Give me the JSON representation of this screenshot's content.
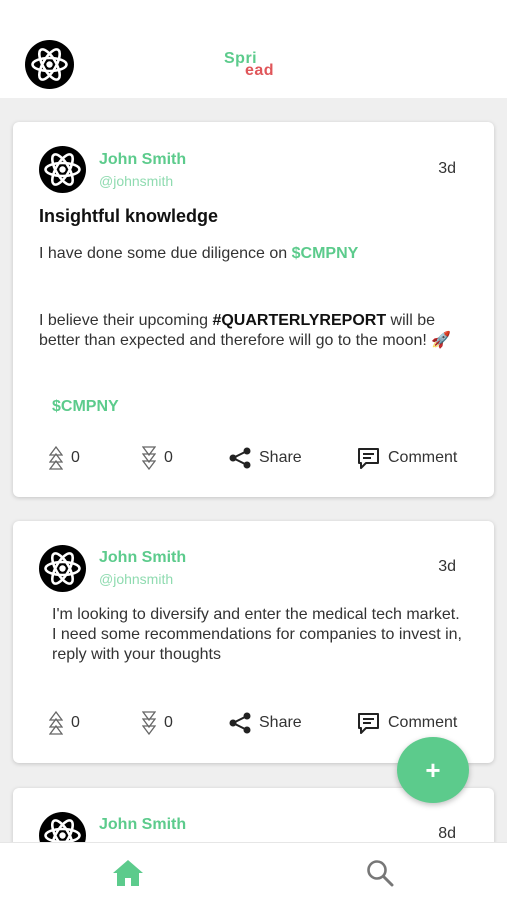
{
  "app": {
    "logo_top": "Spri",
    "logo_bottom": "ead",
    "accent_color": "#5ccb8c",
    "secondary_color": "#e0565a"
  },
  "posts": [
    {
      "author": "John Smith",
      "handle": "@johnsmith",
      "age": "3d",
      "title": "Insightful knowledge",
      "body_1_prefix": "I have done some due diligence on ",
      "body_1_ticker": "$CMPNY",
      "body_2_prefix": "I believe their upcoming ",
      "body_2_hashtag": "#QUARTERLYREPORT",
      "body_2_suffix": " will be better than expected and therefore will go to the moon! 🚀",
      "tag": "$CMPNY",
      "upvotes": "0",
      "downvotes": "0",
      "share_label": "Share",
      "comment_label": "Comment"
    },
    {
      "author": "John Smith",
      "handle": "@johnsmith",
      "age": "3d",
      "body_line_1": "I'm looking to diversify and enter the medical tech market.",
      "body_line_2": "I need some recommendations for companies to invest in, reply with your thoughts",
      "upvotes": "0",
      "downvotes": "0",
      "share_label": "Share",
      "comment_label": "Comment"
    },
    {
      "author": "John Smith",
      "age": "8d"
    }
  ],
  "fab": {
    "label": "+"
  },
  "nav": {
    "home_icon": "home-icon",
    "search_icon": "search-icon"
  }
}
